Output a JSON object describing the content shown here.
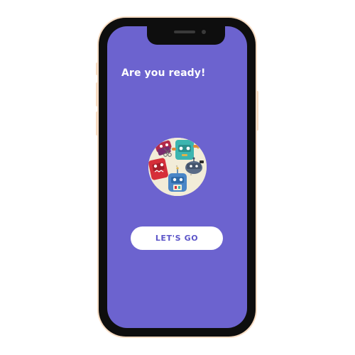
{
  "screen": {
    "title": "Are you ready!",
    "image_icon": "robots-illustration",
    "cta_label": "LET'S GO"
  },
  "colors": {
    "screen_background": "#6c63cf",
    "button_background": "#ffffff",
    "button_text": "#5c55c8",
    "title_text": "#ffffff",
    "phone_frame": "#0e0e0e",
    "phone_accent": "#f7dcc3"
  }
}
